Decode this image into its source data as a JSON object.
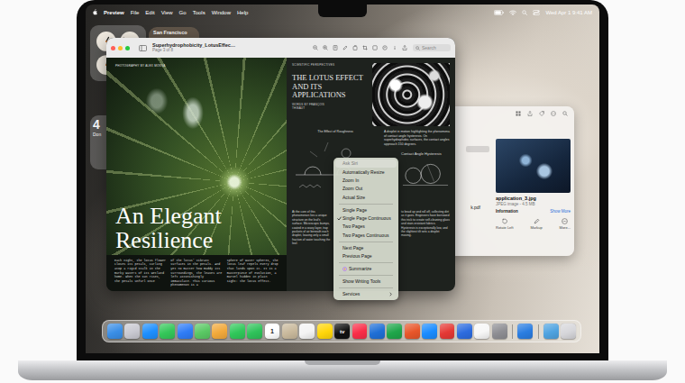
{
  "menubar": {
    "app": "Preview",
    "menus": [
      "File",
      "Edit",
      "View",
      "Go",
      "Tools",
      "Window",
      "Help"
    ],
    "clock": "Wed Apr 1 9:41 AM"
  },
  "widgets": {
    "weather": {
      "city": "San Francisco"
    },
    "reminders": {
      "count": "4",
      "label": "Don"
    }
  },
  "preview": {
    "title": "Superhydrophobicity_LotusEffec…",
    "subtitle": "Page 3 of 8",
    "search": {
      "placeholder": "Search"
    },
    "left_page": {
      "credit": "PHOTOGRAPHY BY ALEX MOSSA",
      "headline": "An Elegant Resilience",
      "columns": [
        "Each night, the lotus flower closes its petals, curling atop a rigid stalk in the murky waters of its wetland home. When the sun rises, the petals unfurl once",
        "of the lotus' vibrant surfaces in the petals. And yet no matter how muddy its surroundings, the leaves are left astonishingly immaculate. This curious phenomenon is a",
        "sphere of water spheres, the lotus leaf repels every drop that lands upon it. It is a masterpiece of evolution, a marvel hidden in plain sight: the lotus effect."
      ]
    },
    "right_page": {
      "kicker": "SCIENTIFIC PERSPECTIVES",
      "title": "THE LOTUS EFFECT AND ITS APPLICATIONS",
      "byline": "WORDS BY FRANÇOIS THIBAUT",
      "intro": "A droplet in motion highlighting the phenomena of contact angle hysteresis. On superhydrophobic surfaces, the contact angles approach 150 degrees.",
      "figures": [
        {
          "caption": "The Effect of Roughness"
        },
        {
          "caption": "Contact Angle Hysteresis"
        }
      ],
      "columns": [
        "At the core of this phenomenon lies a unique structure on the leaf's surface. Microscopic bumps, coated in a waxy layer, trap pockets of air beneath each droplet, leaving only a small fraction of water touching the leaf.",
        "to bead up and roll off, collecting dirt as it goes. Engineers have borrowed this trick to create self-cleaning glass and stain-resistant fabrics. Hysteresis is exceptionally low, and the slightest tilt sets a droplet moving."
      ]
    }
  },
  "context_menu": {
    "items": [
      {
        "kind": "item",
        "label": "Ask Siri",
        "checked": false,
        "disabled": true
      },
      {
        "kind": "item",
        "label": "Automatically Resize",
        "checked": false,
        "disabled": false
      },
      {
        "kind": "item",
        "label": "Zoom In",
        "checked": false,
        "disabled": false
      },
      {
        "kind": "item",
        "label": "Zoom Out",
        "checked": false,
        "disabled": false
      },
      {
        "kind": "item",
        "label": "Actual Size",
        "checked": false,
        "disabled": false
      },
      {
        "kind": "separator"
      },
      {
        "kind": "item",
        "label": "Single Page",
        "checked": false,
        "disabled": false
      },
      {
        "kind": "item",
        "label": "Single Page Continuous",
        "checked": true,
        "disabled": false
      },
      {
        "kind": "item",
        "label": "Two Pages",
        "checked": false,
        "disabled": false
      },
      {
        "kind": "item",
        "label": "Two Pages Continuous",
        "checked": false,
        "disabled": false
      },
      {
        "kind": "separator"
      },
      {
        "kind": "item",
        "label": "Next Page",
        "checked": false,
        "disabled": false
      },
      {
        "kind": "item",
        "label": "Previous Page",
        "checked": false,
        "disabled": false
      },
      {
        "kind": "separator"
      },
      {
        "kind": "ai",
        "label": "Summarize",
        "checked": false,
        "disabled": false
      },
      {
        "kind": "separator"
      },
      {
        "kind": "item",
        "label": "Show Writing Tools",
        "checked": false,
        "disabled": false
      },
      {
        "kind": "separator"
      },
      {
        "kind": "submenu",
        "label": "Services",
        "checked": false,
        "disabled": false
      }
    ]
  },
  "info_window": {
    "files": [
      "k.pdf"
    ],
    "file_name": "application_3.jpg",
    "file_info": "JPEG image - 4.5 MB",
    "section": "Information",
    "show_more": "Show More",
    "actions": [
      "Rotate Left",
      "Markup",
      "More..."
    ]
  },
  "dock": {
    "items": [
      {
        "kind": "app",
        "color": "#3a8ee6"
      },
      {
        "kind": "app",
        "color": "#c9c9d1"
      },
      {
        "kind": "app",
        "color": "#1e8fff"
      },
      {
        "kind": "app",
        "color": "#34c759"
      },
      {
        "kind": "app",
        "color": "#2f7cf6"
      },
      {
        "kind": "app",
        "color": "#5ac864"
      },
      {
        "kind": "app",
        "color": "#f2a93b"
      },
      {
        "kind": "app",
        "color": "#30c85a"
      },
      {
        "kind": "app",
        "color": "#2fc25a"
      },
      {
        "kind": "app",
        "color": "#ffffff",
        "glyph": "1"
      },
      {
        "kind": "app",
        "color": "#c9b99c"
      },
      {
        "kind": "app",
        "color": "#f4f4f4"
      },
      {
        "kind": "app",
        "color": "#ffd60a"
      },
      {
        "kind": "app",
        "color": "#111111",
        "glyph": "tv"
      },
      {
        "kind": "app",
        "color": "#fa2d48"
      },
      {
        "kind": "app",
        "color": "#1f6fd6"
      },
      {
        "kind": "app",
        "color": "#1fa64a"
      },
      {
        "kind": "app",
        "color": "#e8562a"
      },
      {
        "kind": "app",
        "color": "#1a8cff"
      },
      {
        "kind": "app",
        "color": "#e53935"
      },
      {
        "kind": "app",
        "color": "#2d6cdf"
      },
      {
        "kind": "app",
        "color": "#f7f7f7"
      },
      {
        "kind": "app",
        "color": "#8e8e93"
      },
      {
        "kind": "separator"
      },
      {
        "kind": "app",
        "color": "#2a7de1"
      },
      {
        "kind": "separator"
      },
      {
        "kind": "app",
        "color": "#4fa3e0"
      },
      {
        "kind": "app",
        "color": "#d6d6da"
      }
    ]
  }
}
